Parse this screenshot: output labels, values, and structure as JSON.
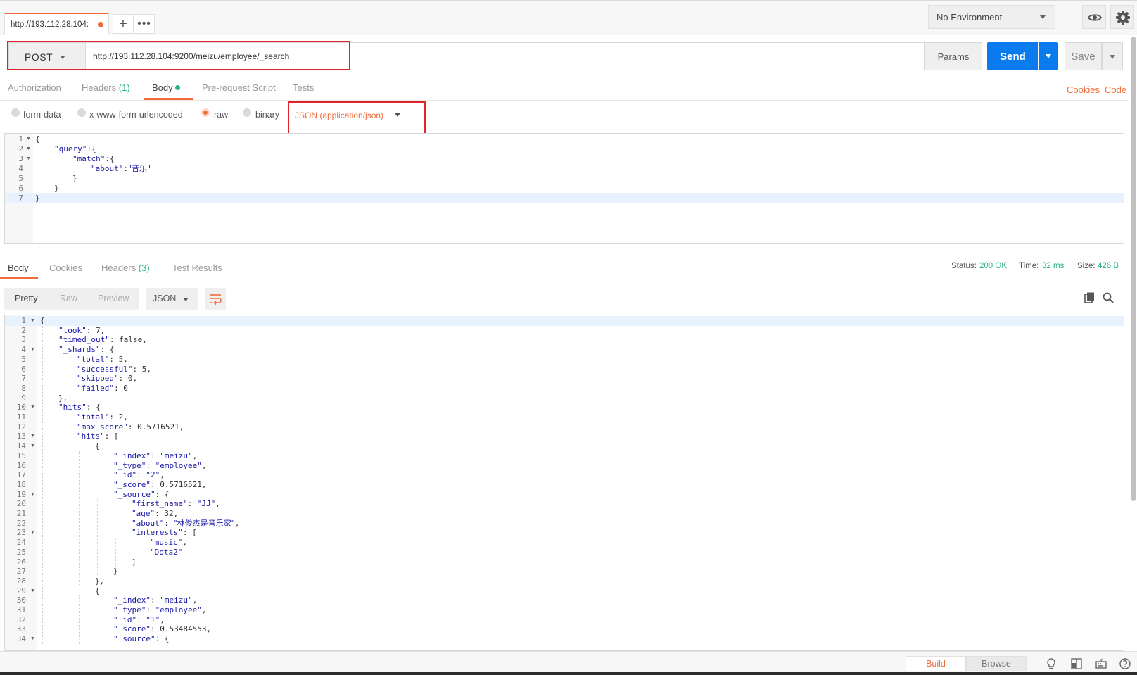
{
  "tabs": {
    "active_tab_label": "http://193.112.28.104:",
    "new_tab_symbol": "+",
    "more_symbol": "•••"
  },
  "environment": {
    "selected": "No Environment"
  },
  "request": {
    "method": "POST",
    "url": "http://193.112.28.104:9200/meizu/employee/_search",
    "params_label": "Params",
    "send_label": "Send",
    "save_label": "Save"
  },
  "request_tabs": {
    "authorization": "Authorization",
    "headers": "Headers",
    "headers_count": "(1)",
    "body": "Body",
    "pre_request": "Pre-request Script",
    "tests": "Tests",
    "cookies": "Cookies",
    "code": "Code"
  },
  "body_types": {
    "form_data": "form-data",
    "urlencoded": "x-www-form-urlencoded",
    "raw": "raw",
    "binary": "binary",
    "content_type": "JSON (application/json)"
  },
  "request_body": {
    "line_numbers": [
      "1",
      "2",
      "3",
      "4",
      "5",
      "6",
      "7"
    ],
    "l1": "{",
    "l2_key": "\"query\"",
    "l2_rest": ":{",
    "l3_key": "\"match\"",
    "l3_rest": ":{",
    "l4_key": "\"about\"",
    "l4_colon": ":",
    "l4_val": "\"音乐\"",
    "l5": "}",
    "l6": "}",
    "l7": "}"
  },
  "response_tabs": {
    "body": "Body",
    "cookies": "Cookies",
    "headers": "Headers",
    "headers_count": "(3)",
    "test_results": "Test Results"
  },
  "response_status": {
    "status_label": "Status:",
    "status_value": "200 OK",
    "time_label": "Time:",
    "time_value": "32 ms",
    "size_label": "Size:",
    "size_value": "426 B"
  },
  "response_toolbar": {
    "pretty": "Pretty",
    "raw": "Raw",
    "preview": "Preview",
    "format": "JSON"
  },
  "response_body": {
    "lines": [
      {
        "n": "1",
        "fold": true,
        "indent": 0,
        "parts": [
          [
            "p",
            "{"
          ]
        ]
      },
      {
        "n": "2",
        "fold": false,
        "indent": 1,
        "parts": [
          [
            "k",
            "\"took\""
          ],
          [
            "p",
            ": 7,"
          ]
        ]
      },
      {
        "n": "3",
        "fold": false,
        "indent": 1,
        "parts": [
          [
            "k",
            "\"timed_out\""
          ],
          [
            "p",
            ": false,"
          ]
        ]
      },
      {
        "n": "4",
        "fold": true,
        "indent": 1,
        "parts": [
          [
            "k",
            "\"_shards\""
          ],
          [
            "p",
            ": {"
          ]
        ]
      },
      {
        "n": "5",
        "fold": false,
        "indent": 2,
        "parts": [
          [
            "k",
            "\"total\""
          ],
          [
            "p",
            ": 5,"
          ]
        ]
      },
      {
        "n": "6",
        "fold": false,
        "indent": 2,
        "parts": [
          [
            "k",
            "\"successful\""
          ],
          [
            "p",
            ": 5,"
          ]
        ]
      },
      {
        "n": "7",
        "fold": false,
        "indent": 2,
        "parts": [
          [
            "k",
            "\"skipped\""
          ],
          [
            "p",
            ": 0,"
          ]
        ]
      },
      {
        "n": "8",
        "fold": false,
        "indent": 2,
        "parts": [
          [
            "k",
            "\"failed\""
          ],
          [
            "p",
            ": 0"
          ]
        ]
      },
      {
        "n": "9",
        "fold": false,
        "indent": 1,
        "parts": [
          [
            "p",
            "},"
          ]
        ]
      },
      {
        "n": "10",
        "fold": true,
        "indent": 1,
        "parts": [
          [
            "k",
            "\"hits\""
          ],
          [
            "p",
            ": {"
          ]
        ]
      },
      {
        "n": "11",
        "fold": false,
        "indent": 2,
        "parts": [
          [
            "k",
            "\"total\""
          ],
          [
            "p",
            ": 2,"
          ]
        ]
      },
      {
        "n": "12",
        "fold": false,
        "indent": 2,
        "parts": [
          [
            "k",
            "\"max_score\""
          ],
          [
            "p",
            ": 0.5716521,"
          ]
        ]
      },
      {
        "n": "13",
        "fold": true,
        "indent": 2,
        "parts": [
          [
            "k",
            "\"hits\""
          ],
          [
            "p",
            ": ["
          ]
        ]
      },
      {
        "n": "14",
        "fold": true,
        "indent": 3,
        "parts": [
          [
            "p",
            "{"
          ]
        ]
      },
      {
        "n": "15",
        "fold": false,
        "indent": 4,
        "parts": [
          [
            "k",
            "\"_index\""
          ],
          [
            "p",
            ": "
          ],
          [
            "s",
            "\"meizu\""
          ],
          [
            "p",
            ","
          ]
        ]
      },
      {
        "n": "16",
        "fold": false,
        "indent": 4,
        "parts": [
          [
            "k",
            "\"_type\""
          ],
          [
            "p",
            ": "
          ],
          [
            "s",
            "\"employee\""
          ],
          [
            "p",
            ","
          ]
        ]
      },
      {
        "n": "17",
        "fold": false,
        "indent": 4,
        "parts": [
          [
            "k",
            "\"_id\""
          ],
          [
            "p",
            ": "
          ],
          [
            "s",
            "\"2\""
          ],
          [
            "p",
            ","
          ]
        ]
      },
      {
        "n": "18",
        "fold": false,
        "indent": 4,
        "parts": [
          [
            "k",
            "\"_score\""
          ],
          [
            "p",
            ": 0.5716521,"
          ]
        ]
      },
      {
        "n": "19",
        "fold": true,
        "indent": 4,
        "parts": [
          [
            "k",
            "\"_source\""
          ],
          [
            "p",
            ": {"
          ]
        ]
      },
      {
        "n": "20",
        "fold": false,
        "indent": 5,
        "parts": [
          [
            "k",
            "\"first_name\""
          ],
          [
            "p",
            ": "
          ],
          [
            "s",
            "\"JJ\""
          ],
          [
            "p",
            ","
          ]
        ]
      },
      {
        "n": "21",
        "fold": false,
        "indent": 5,
        "parts": [
          [
            "k",
            "\"age\""
          ],
          [
            "p",
            ": 32,"
          ]
        ]
      },
      {
        "n": "22",
        "fold": false,
        "indent": 5,
        "parts": [
          [
            "k",
            "\"about\""
          ],
          [
            "p",
            ": "
          ],
          [
            "s",
            "\"林俊杰是音乐家\""
          ],
          [
            "p",
            ","
          ]
        ]
      },
      {
        "n": "23",
        "fold": true,
        "indent": 5,
        "parts": [
          [
            "k",
            "\"interests\""
          ],
          [
            "p",
            ": ["
          ]
        ]
      },
      {
        "n": "24",
        "fold": false,
        "indent": 6,
        "parts": [
          [
            "s",
            "\"music\""
          ],
          [
            "p",
            ","
          ]
        ]
      },
      {
        "n": "25",
        "fold": false,
        "indent": 6,
        "parts": [
          [
            "s",
            "\"Dota2\""
          ]
        ]
      },
      {
        "n": "26",
        "fold": false,
        "indent": 5,
        "parts": [
          [
            "p",
            "]"
          ]
        ]
      },
      {
        "n": "27",
        "fold": false,
        "indent": 4,
        "parts": [
          [
            "p",
            "}"
          ]
        ]
      },
      {
        "n": "28",
        "fold": false,
        "indent": 3,
        "parts": [
          [
            "p",
            "},"
          ]
        ]
      },
      {
        "n": "29",
        "fold": true,
        "indent": 3,
        "parts": [
          [
            "p",
            "{"
          ]
        ]
      },
      {
        "n": "30",
        "fold": false,
        "indent": 4,
        "parts": [
          [
            "k",
            "\"_index\""
          ],
          [
            "p",
            ": "
          ],
          [
            "s",
            "\"meizu\""
          ],
          [
            "p",
            ","
          ]
        ]
      },
      {
        "n": "31",
        "fold": false,
        "indent": 4,
        "parts": [
          [
            "k",
            "\"_type\""
          ],
          [
            "p",
            ": "
          ],
          [
            "s",
            "\"employee\""
          ],
          [
            "p",
            ","
          ]
        ]
      },
      {
        "n": "32",
        "fold": false,
        "indent": 4,
        "parts": [
          [
            "k",
            "\"_id\""
          ],
          [
            "p",
            ": "
          ],
          [
            "s",
            "\"1\""
          ],
          [
            "p",
            ","
          ]
        ]
      },
      {
        "n": "33",
        "fold": false,
        "indent": 4,
        "parts": [
          [
            "k",
            "\"_score\""
          ],
          [
            "p",
            ": 0.53484553,"
          ]
        ]
      },
      {
        "n": "34",
        "fold": true,
        "indent": 4,
        "parts": [
          [
            "k",
            "\"_source\""
          ],
          [
            "p",
            ": {"
          ]
        ]
      }
    ]
  },
  "statusbar": {
    "build": "Build",
    "browse": "Browse"
  },
  "colors": {
    "accent": "#f26b3a",
    "send_blue": "#097bed",
    "status_green": "#26b47f",
    "annotation_red": "#e0242b",
    "json_key": "#1a1aa6"
  },
  "icons": [
    "eye-icon",
    "gear-icon",
    "wrap-lines-icon",
    "copy-icon",
    "search-icon",
    "bulb-icon",
    "two-pane-icon",
    "keyboard-icon",
    "help-icon"
  ]
}
